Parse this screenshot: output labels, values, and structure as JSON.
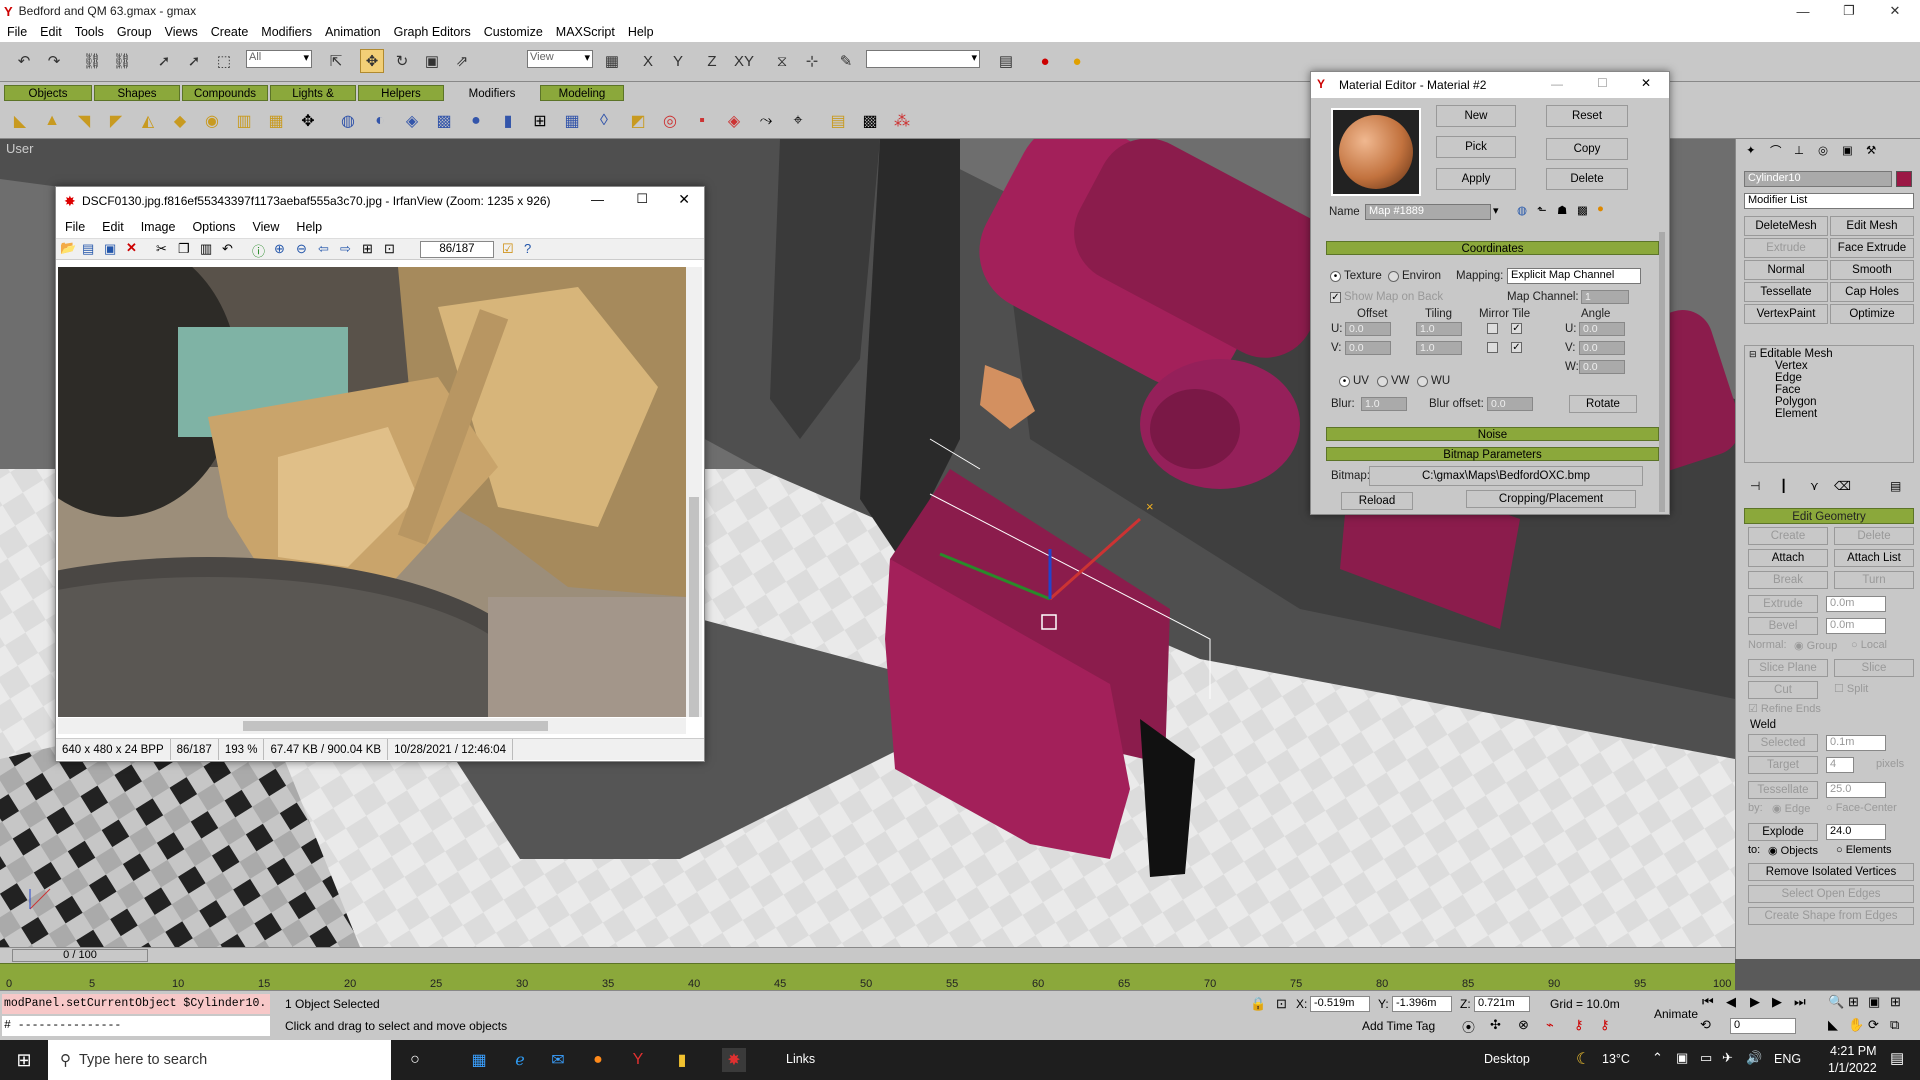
{
  "app": {
    "title": "Bedford and QM 63.gmax - gmax",
    "menu": [
      "File",
      "Edit",
      "Tools",
      "Group",
      "Views",
      "Create",
      "Modifiers",
      "Animation",
      "Graph Editors",
      "Customize",
      "MAXScript",
      "Help"
    ]
  },
  "toolbar": {
    "selection_filter": "All",
    "ref_coord": "View"
  },
  "create_tabs": [
    "Objects",
    "Shapes",
    "Compounds",
    "Lights & Cameras",
    "Helpers",
    "Modifiers",
    "Modeling"
  ],
  "selected_create_tab": "Modifiers",
  "viewport": {
    "label": "User"
  },
  "irfanview": {
    "title": "DSCF0130.jpg.f816ef55343397f1173aebaf555a3c70.jpg - IrfanView (Zoom: 1235 x 926)",
    "menu": [
      "File",
      "Edit",
      "Image",
      "Options",
      "View",
      "Help"
    ],
    "page_box": "86/187",
    "status": [
      "640 x 480 x 24 BPP",
      "86/187",
      "193 %",
      "67.47 KB / 900.04 KB",
      "10/28/2021 / 12:46:04"
    ]
  },
  "material_editor": {
    "title": "Material Editor - Material #2",
    "buttons": {
      "new": "New",
      "reset": "Reset",
      "pick": "Pick",
      "copy": "Copy",
      "apply": "Apply",
      "delete": "Delete"
    },
    "name_label": "Name",
    "name_value": "Map #1889",
    "coordinates": {
      "header": "Coordinates",
      "texture": "Texture",
      "environ": "Environ",
      "mapping_label": "Mapping:",
      "mapping_value": "Explicit Map Channel",
      "show_map_on_back": "Show Map on Back",
      "map_channel_label": "Map Channel:",
      "map_channel_value": "1",
      "offset": "Offset",
      "tiling": "Tiling",
      "mirror_tile": "Mirror Tile",
      "angle": "Angle",
      "u_offset": "0.0",
      "v_offset": "0.0",
      "u_tiling": "1.0",
      "v_tiling": "1.0",
      "u_angle": "0.0",
      "v_angle": "0.0",
      "w_angle": "0.0",
      "uv": "UV",
      "vw": "VW",
      "wu": "WU",
      "blur_label": "Blur:",
      "blur_value": "1.0",
      "blur_offset_label": "Blur offset:",
      "blur_offset_value": "0.0",
      "rotate": "Rotate"
    },
    "noise_header": "Noise",
    "bitmap_params_header": "Bitmap Parameters",
    "bitmap_label": "Bitmap:",
    "bitmap_path": "C:\\gmax\\Maps\\BedfordOXC.bmp",
    "reload": "Reload",
    "cropping": "Cropping/Placement"
  },
  "command_panel": {
    "object_name": "Cylinder10",
    "modifier_list": "Modifier List",
    "buttons": [
      "DeleteMesh",
      "Edit Mesh",
      "Extrude",
      "Face Extrude",
      "Normal",
      "Smooth",
      "Tessellate",
      "Cap Holes",
      "VertexPaint",
      "Optimize"
    ],
    "stack": [
      "Editable Mesh",
      "Vertex",
      "Edge",
      "Face",
      "Polygon",
      "Element"
    ],
    "edit_geometry": "Edit Geometry",
    "geo_buttons": [
      "Create",
      "Delete",
      "Attach",
      "Attach List",
      "Break",
      "Turn",
      "Extrude",
      "Bevel",
      "Slice Plane",
      "Slice",
      "Cut",
      "Tessellate",
      "Explode",
      "Remove Isolated Vertices",
      "Select Open Edges",
      "Create Shape from Edges"
    ],
    "extrude_val": "0.0m",
    "bevel_val": "0.0m",
    "normal_label": "Normal:",
    "group": "Group",
    "local": "Local",
    "split": "Split",
    "refine_ends": "Refine Ends",
    "weld": "Weld",
    "selected": "Selected",
    "selected_val": "0.1m",
    "target": "Target",
    "target_val": "4",
    "pixels": "pixels",
    "tess_val": "25.0",
    "by": "by:",
    "edge": "Edge",
    "face_center": "Face-Center",
    "explode_val": "24.0",
    "to": "to:",
    "objects": "Objects",
    "elements": "Elements"
  },
  "timeline": {
    "slider": "0 / 100",
    "ticks": [
      "0",
      "5",
      "10",
      "15",
      "20",
      "25",
      "30",
      "35",
      "40",
      "45",
      "50",
      "55",
      "60",
      "65",
      "70",
      "75",
      "80",
      "85",
      "90",
      "95",
      "100"
    ]
  },
  "status": {
    "maxscript1": "modPanel.setCurrentObject $Cylinder10.",
    "maxscript2": "# ---------------",
    "selected": "1 Object Selected",
    "prompt": "Click and drag to select and move objects",
    "x": "-0.519m",
    "y": "-1.396m",
    "z": "0.721m",
    "grid": "Grid = 10.0m",
    "add_time_tag": "Add Time Tag",
    "animate": "Animate",
    "frame": "0"
  },
  "taskbar": {
    "search_placeholder": "Type here to search",
    "links": "Links",
    "desktop": "Desktop",
    "temp": "13°C",
    "lang": "ENG",
    "time": "4:21 PM",
    "date": "1/1/2022"
  }
}
